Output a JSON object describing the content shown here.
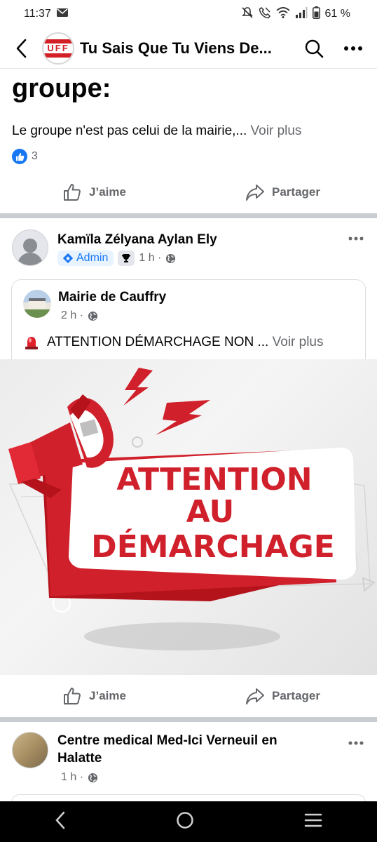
{
  "status_bar": {
    "time": "11:37",
    "battery": "61 %"
  },
  "header": {
    "group_logo_text": "UFF",
    "title": "Tu Sais Que Tu Viens De..."
  },
  "post_prev": {
    "heading": "groupe:",
    "text": "Le groupe n'est pas celui de la mairie,... ",
    "see_more": "Voir plus",
    "reaction_count": "3",
    "like_label": "J’aime",
    "share_label": "Partager"
  },
  "post_shared": {
    "author_name": "Kamïla Zélyana Aylan Ely",
    "role_badge": "Admin",
    "time": "1 h ·",
    "like_label": "J’aime",
    "share_label": "Partager",
    "original": {
      "page_name": "Mairie de Cauffry",
      "time": "2 h ·",
      "text": "ATTENTION DÉMARCHAGE NON ... ",
      "see_more": "Voir plus",
      "image_lines": [
        "ATTENTION",
        "AU",
        "DÉMARCHAGE"
      ]
    }
  },
  "post_next": {
    "author_name": "Centre medical Med-Ici Verneuil en Halatte",
    "time": "1 h ·"
  },
  "colors": {
    "brand_blue": "#1877f2",
    "alert_red": "#d0202b",
    "secondary_text": "#65676b"
  }
}
